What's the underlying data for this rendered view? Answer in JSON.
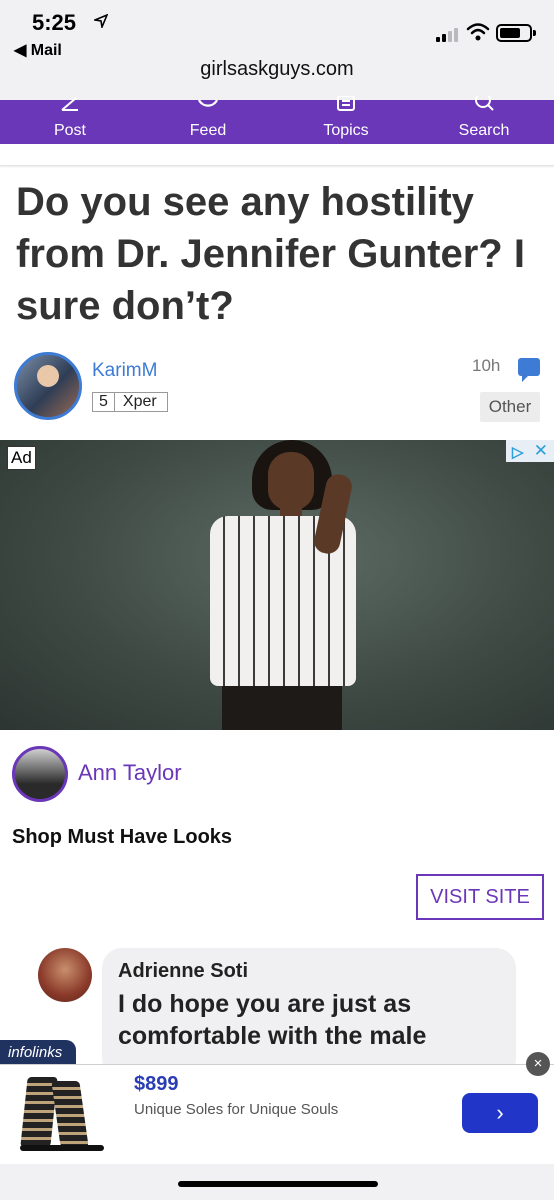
{
  "status_bar": {
    "time": "5:25",
    "location_icon": "location-arrow-icon",
    "back_label": "◀ Mail",
    "url": "girlsaskguys.com"
  },
  "nav": {
    "items": [
      {
        "label": "Post",
        "icon": "pencil-icon"
      },
      {
        "label": "Feed",
        "icon": "feed-icon"
      },
      {
        "label": "Topics",
        "icon": "topics-icon"
      },
      {
        "label": "Search",
        "icon": "search-icon"
      }
    ],
    "color": "#6a37b8"
  },
  "question": {
    "title": "Do you see any hostility from Dr. Jennifer Gunter? I sure don’t?",
    "author": "KarimM",
    "level_num": "5",
    "level_rank": "Xper",
    "age": "10h",
    "category": "Other"
  },
  "ad": {
    "label": "Ad",
    "brand": "Ann Taylor",
    "headline": "Shop Must Have Looks",
    "cta": "VISIT SITE"
  },
  "embed": {
    "name": "Adrienne Soti",
    "text": "I do hope you are just as comfortable with the male"
  },
  "bottom_ad": {
    "network": "infolinks",
    "price": "$899",
    "tagline": "Unique Soles for Unique Souls",
    "cta_icon": "chevron-right-icon",
    "close": "×"
  },
  "colors": {
    "accent": "#6a37b8",
    "link": "#3d7bd4",
    "cta_blue": "#2136c9"
  }
}
